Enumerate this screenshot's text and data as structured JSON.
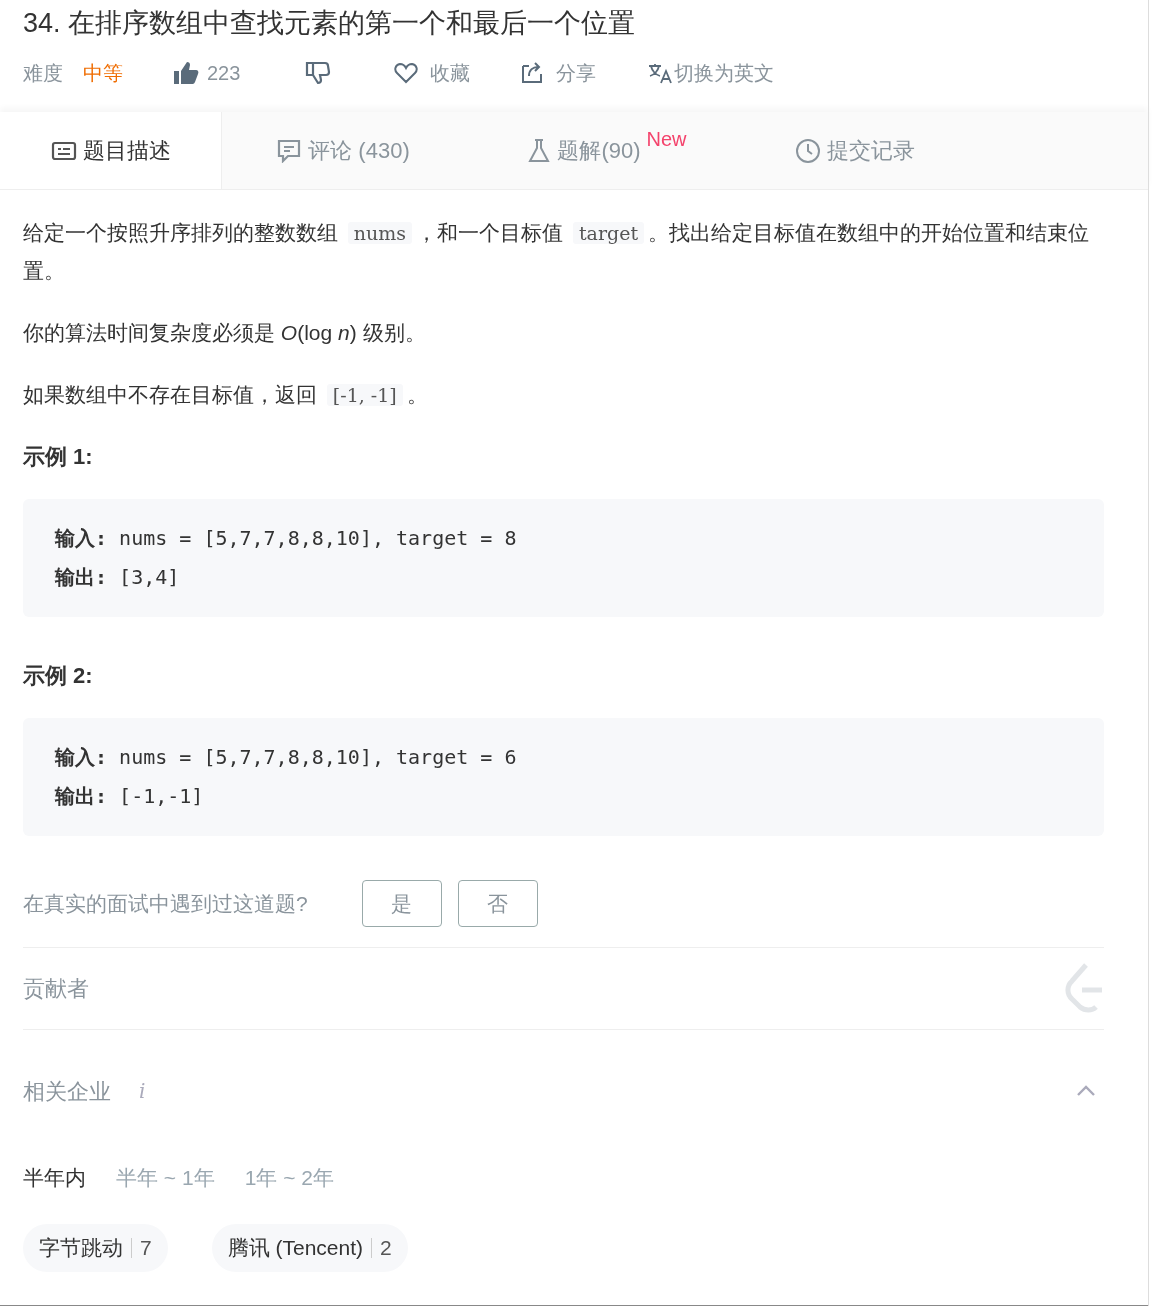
{
  "title": "34. 在排序数组中查找元素的第一个和最后一个位置",
  "meta": {
    "difficulty_label": "难度",
    "difficulty": "中等",
    "likes": "223",
    "favorite": "收藏",
    "share": "分享",
    "switch_language": "切换为英文"
  },
  "tabs": [
    {
      "kind": "description",
      "label": "题目描述",
      "selected": true
    },
    {
      "kind": "comments",
      "label": "评论 (430)",
      "selected": false
    },
    {
      "kind": "solutions",
      "label": "题解(90)",
      "badge": "New",
      "selected": false
    },
    {
      "kind": "submissions",
      "label": "提交记录",
      "selected": false
    }
  ],
  "description": [
    {
      "segments": [
        {
          "kind": "text",
          "text": "给定一个按照升序排列的整数数组 "
        },
        {
          "kind": "code",
          "text": "nums"
        },
        {
          "kind": "text",
          "text": "，和一个目标值 "
        },
        {
          "kind": "code",
          "text": "target"
        },
        {
          "kind": "text",
          "text": "。找出给定目标值在数组中的开始位置和结束位置。"
        }
      ]
    },
    {
      "segments": [
        {
          "kind": "text",
          "text": "你的算法时间复杂度必须是 *O*(log *n*) 级别。"
        }
      ]
    },
    {
      "segments": [
        {
          "kind": "text",
          "text": "如果数组中不存在目标值，返回 "
        },
        {
          "kind": "code",
          "text": "[-1, -1]"
        },
        {
          "kind": "text",
          "text": "。"
        }
      ]
    }
  ],
  "examples": [
    {
      "heading": "示例 1:",
      "lines": [
        "**输入:** nums = [5,7,7,8,8,10], target = 8",
        "**输出:** [3,4]"
      ]
    },
    {
      "heading": "示例 2:",
      "lines": [
        "**输入:** nums = [5,7,7,8,8,10], target = 6",
        "**输出:** [-1,-1]"
      ]
    }
  ],
  "interview": {
    "question": "在真实的面试中遇到过这道题?",
    "buttons": [
      "是",
      "否"
    ]
  },
  "contributors": {
    "label": "贡献者"
  },
  "companies": {
    "label": "相关企业",
    "info": "i",
    "expanded": true,
    "periods": [
      {
        "label": "半年内",
        "selected": true
      },
      {
        "label": "半年 ~ 1年",
        "selected": false
      },
      {
        "label": "1年 ~ 2年",
        "selected": false
      }
    ],
    "tags": [
      {
        "name": "字节跳动",
        "count": "7"
      },
      {
        "name": "腾讯 (Tencent)",
        "count": "2"
      }
    ]
  }
}
